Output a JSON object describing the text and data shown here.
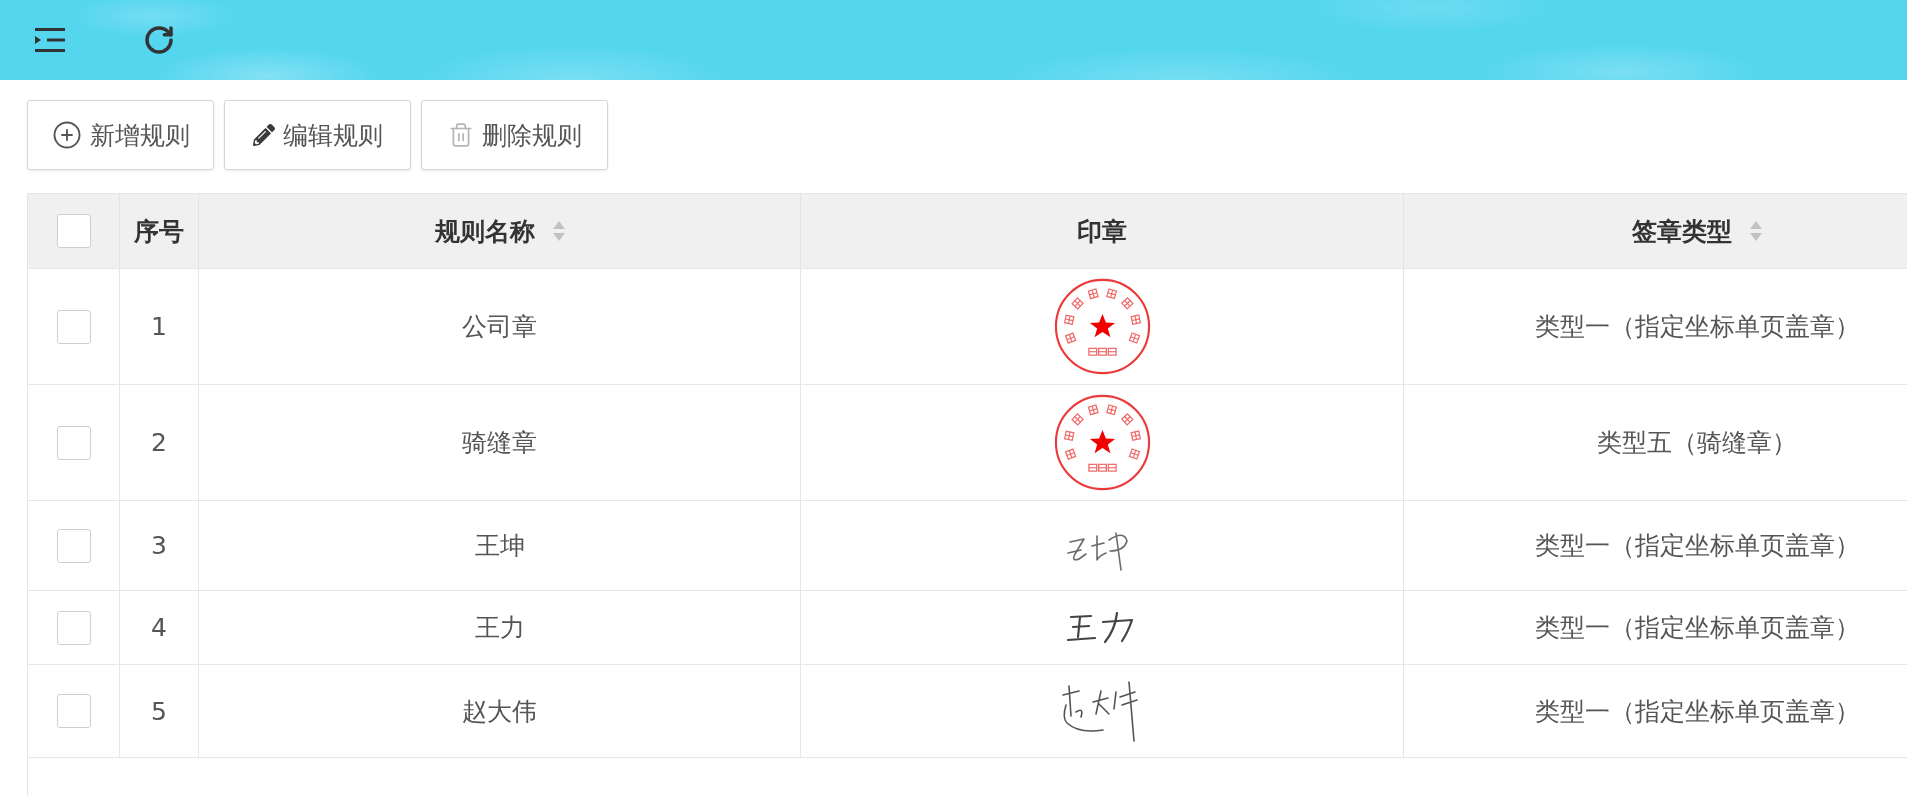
{
  "actions": [
    {
      "kind": "add",
      "label": "新增规则"
    },
    {
      "kind": "edit",
      "label": "编辑规则"
    },
    {
      "kind": "delete",
      "label": "删除规则"
    }
  ],
  "table": {
    "select_all": {
      "checked": false
    },
    "columns": [
      {
        "label": "序号",
        "sortable": false
      },
      {
        "label": "规则名称",
        "sortable": true
      },
      {
        "label": "印章",
        "sortable": false
      },
      {
        "label": "签章类型",
        "sortable": true
      }
    ],
    "rows": [
      {
        "checked": false,
        "index": "1",
        "name": "公司章",
        "stamp": {
          "kind": "seal"
        },
        "type": "类型一（指定坐标单页盖章）"
      },
      {
        "checked": false,
        "index": "2",
        "name": "骑缝章",
        "stamp": {
          "kind": "seal"
        },
        "type": "类型五（骑缝章）"
      },
      {
        "checked": false,
        "index": "3",
        "name": "王坤",
        "stamp": {
          "kind": "signature"
        },
        "type": "类型一（指定坐标单页盖章）"
      },
      {
        "checked": false,
        "index": "4",
        "name": "王力",
        "stamp": {
          "kind": "signature"
        },
        "type": "类型一（指定坐标单页盖章）"
      },
      {
        "checked": false,
        "index": "5",
        "name": "赵大伟",
        "stamp": {
          "kind": "signature"
        },
        "type": "类型一（指定坐标单页盖章）"
      }
    ]
  }
}
